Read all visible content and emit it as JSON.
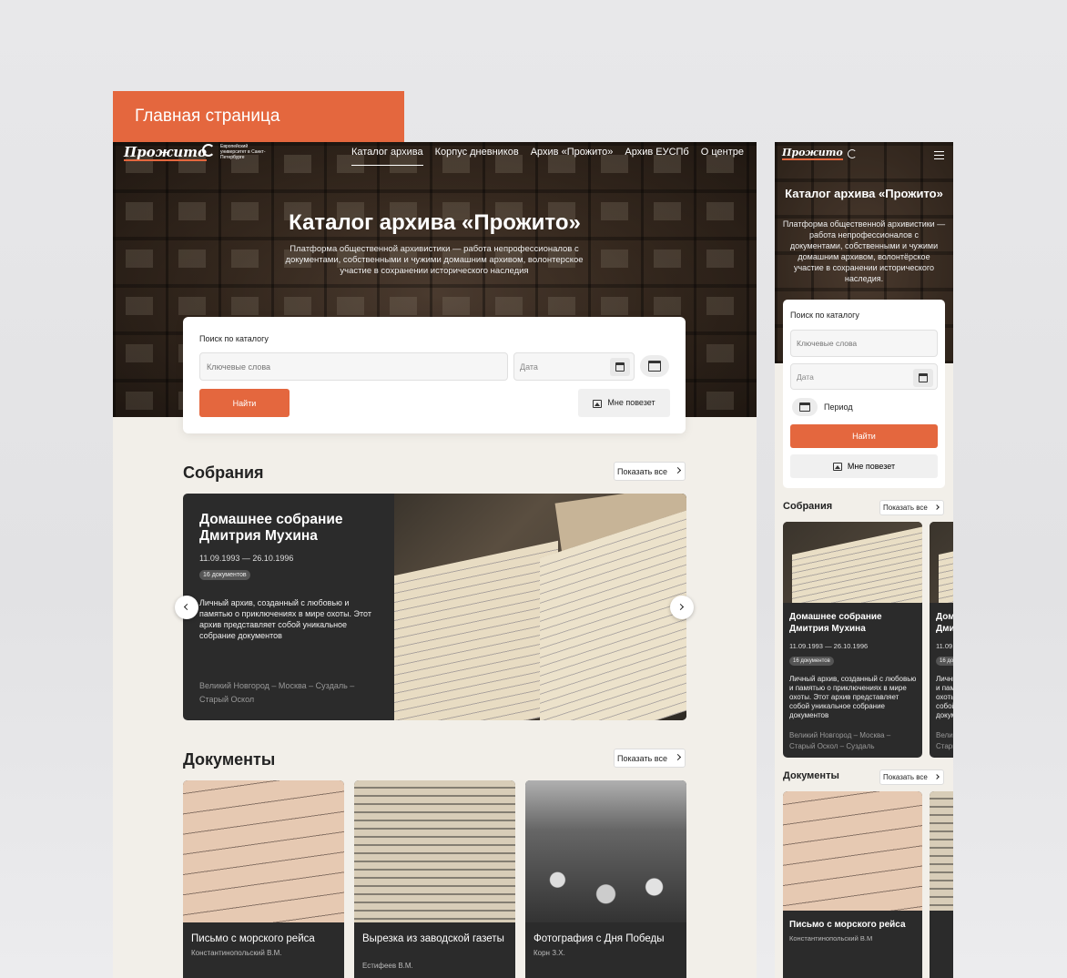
{
  "page_label": "Главная страница",
  "desktop": {
    "logo": "Прожито",
    "university_mark": "Европейский университет в Санкт-Петербурге",
    "nav": [
      "Каталог архива",
      "Корпус дневников",
      "Архив «Прожито»",
      "Архив ЕУСПб",
      "О центре"
    ],
    "active_nav": "Каталог архива",
    "hero_title": "Каталог архива «Прожито»",
    "hero_subtitle": "Платформа общественной архивистики — работа непрофессионалов с документами, собственными и чужими домашним архивом, волонтерское участие в сохранении исторического наследия",
    "search": {
      "label": "Поиск по каталогу",
      "keywords_placeholder": "Ключевые слова",
      "date_placeholder": "Дата",
      "find_button": "Найти",
      "lucky_button": "Мне повезет"
    },
    "collections": {
      "title": "Собрания",
      "show_all": "Показать все",
      "card": {
        "title": "Домашнее собрание Дмитрия Мухина",
        "dates": "11.09.1993 — 26.10.1996",
        "badge": "16 документов",
        "description": "Личный архив, созданный с любовью и памятью о приключениях в мире охоты. Этот архив представляет собой уникальное собрание документов",
        "places": "Великий Новгород – Москва – Суздаль – Старый Оскол"
      }
    },
    "documents": {
      "title": "Документы",
      "show_all": "Показать все",
      "items": [
        {
          "title": "Письмо с морского рейса",
          "author": "Константинопольский В.М."
        },
        {
          "title": "Вырезка из заводской газеты",
          "author": "Естифеев В.М."
        },
        {
          "title": "Фотография с Дня Победы",
          "author": "Корн З.Х."
        }
      ]
    }
  },
  "mobile": {
    "logo": "Прожито",
    "hero_title": "Каталог архива «Прожито»",
    "hero_subtitle": "Платформа общественной архивистики — работа непрофессионалов с документами, собственными и чужими домашним архивом, волонтёрское участие в сохранении исторического наследия.",
    "search": {
      "label": "Поиск по каталогу",
      "keywords_placeholder": "Ключевые слова",
      "date_placeholder": "Дата",
      "period_label": "Период",
      "find_button": "Найти",
      "lucky_button": "Мне повезет"
    },
    "collections": {
      "title": "Собрания",
      "show_all": "Показать все",
      "card": {
        "title": "Домашнее собрание Дмитрия Мухина",
        "dates": "11.09.1993 — 26.10.1996",
        "badge": "16 документов",
        "description": "Личный архив, созданный с любовью и памятью о приключениях в мире охоты. Этот архив представляет собой уникальное собрание документов",
        "places": "Великий Новгород – Москва – Старый Оскол – Суздаль"
      }
    },
    "documents": {
      "title": "Документы",
      "show_all": "Показать все",
      "item": {
        "title": "Письмо с морского рейса",
        "author": "Константинопольский В.М"
      }
    }
  },
  "colors": {
    "accent": "#e4673e",
    "card_dark": "#2b2b2b",
    "page_bg": "#f2efe9"
  }
}
